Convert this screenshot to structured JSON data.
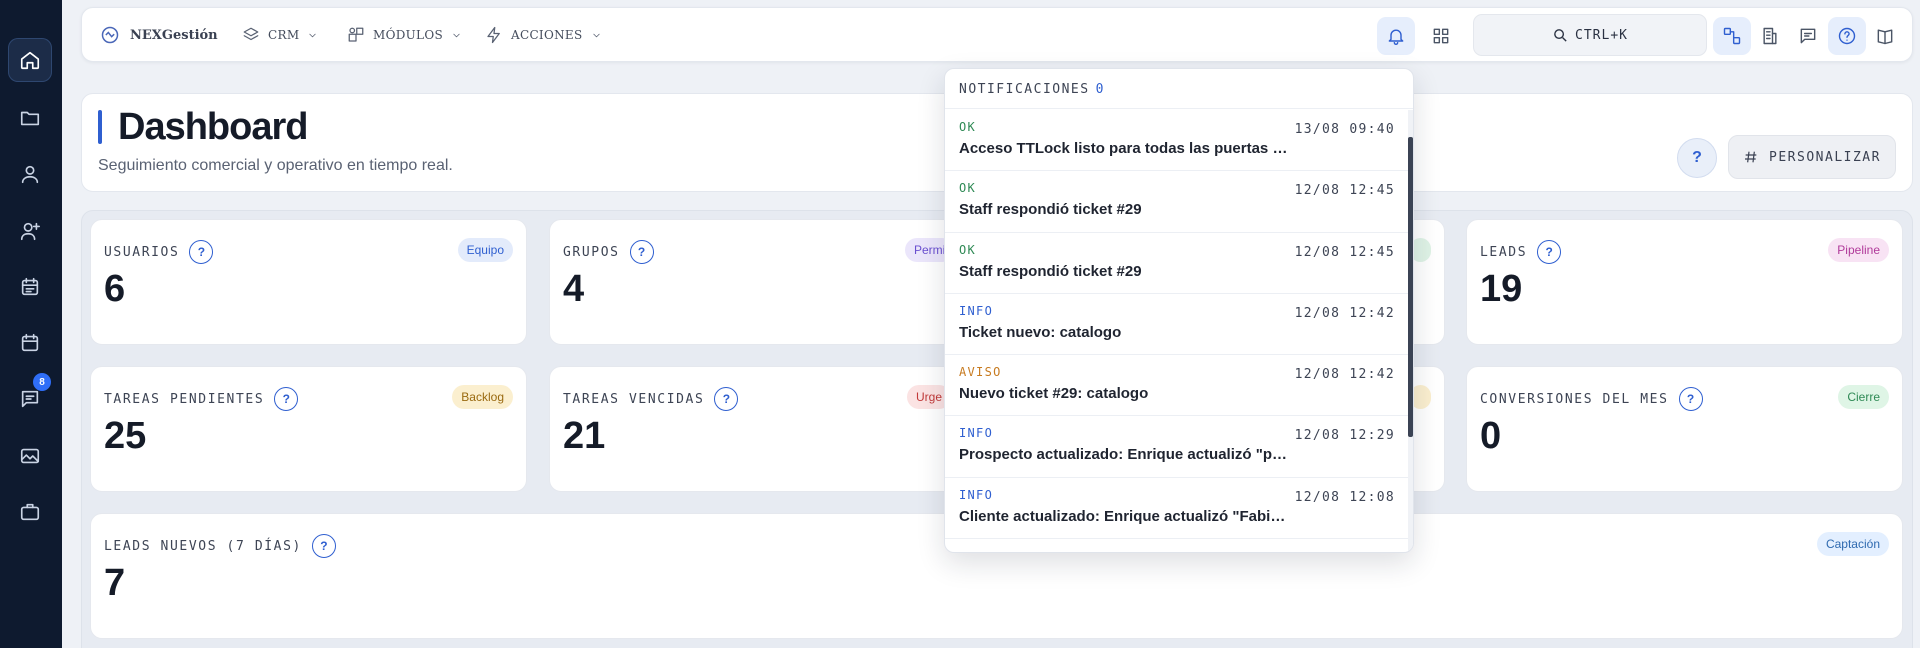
{
  "brand": {
    "name": "NEXGestión"
  },
  "nav": {
    "crm": "CRM",
    "modulos": "MÓDULOS",
    "acciones": "ACCIONES"
  },
  "search": {
    "shortcut": "CTRL+K"
  },
  "sidebar": {
    "items": [
      {
        "icon": "home-icon"
      },
      {
        "icon": "folder-icon"
      },
      {
        "icon": "user-icon"
      },
      {
        "icon": "user-plus-icon"
      },
      {
        "icon": "calendar-list-icon"
      },
      {
        "icon": "calendar-icon"
      },
      {
        "icon": "message-icon",
        "badge": "8"
      },
      {
        "icon": "image-icon"
      },
      {
        "icon": "briefcase-icon"
      }
    ]
  },
  "header": {
    "title": "Dashboard",
    "subtitle": "Seguimiento comercial y operativo en tiempo real.",
    "help": "?",
    "customize": "PERSONALIZAR"
  },
  "stats": [
    {
      "label": "USUARIOS",
      "value": "6",
      "badge": "Equipo"
    },
    {
      "label": "GRUPOS",
      "value": "4",
      "badge": "Permi"
    },
    {
      "label": "LEADS",
      "value": "19",
      "badge": "Pipeline"
    },
    {
      "label": "TAREAS PENDIENTES",
      "value": "25",
      "badge": "Backlog"
    },
    {
      "label": "TAREAS VENCIDAS",
      "value": "21",
      "badge": "Urge"
    },
    {
      "label": "CONVERSIONES DEL MES",
      "value": "0",
      "badge": "Cierre"
    },
    {
      "label": "LEADS NUEVOS (7 DÍAS)",
      "value": "7",
      "badge": "Captación"
    }
  ],
  "notifications": {
    "title": "NOTIFICACIONES",
    "count": "0",
    "items": [
      {
        "level": "OK",
        "time": "13/08 09:40",
        "text": "Acceso TTLock listo para todas las puertas de l..."
      },
      {
        "level": "OK",
        "time": "12/08 12:45",
        "text": "Staff respondió ticket #29"
      },
      {
        "level": "OK",
        "time": "12/08 12:45",
        "text": "Staff respondió ticket #29"
      },
      {
        "level": "INFO",
        "time": "12/08 12:42",
        "text": "Ticket nuevo: catalogo"
      },
      {
        "level": "AVISO",
        "time": "12/08 12:42",
        "text": "Nuevo ticket #29: catalogo"
      },
      {
        "level": "INFO",
        "time": "12/08 12:29",
        "text": "Prospecto actualizado: Enrique actualizó \"prue..."
      },
      {
        "level": "INFO",
        "time": "12/08 12:08",
        "text": "Cliente actualizado: Enrique actualizó \"Fabian ..."
      }
    ]
  },
  "colors": {
    "accent": "#2f5fd0",
    "sidebar_bg": "#0e1a2f",
    "ok": "#2f8a55",
    "info": "#2f5fd0",
    "aviso": "#c77a1f"
  }
}
